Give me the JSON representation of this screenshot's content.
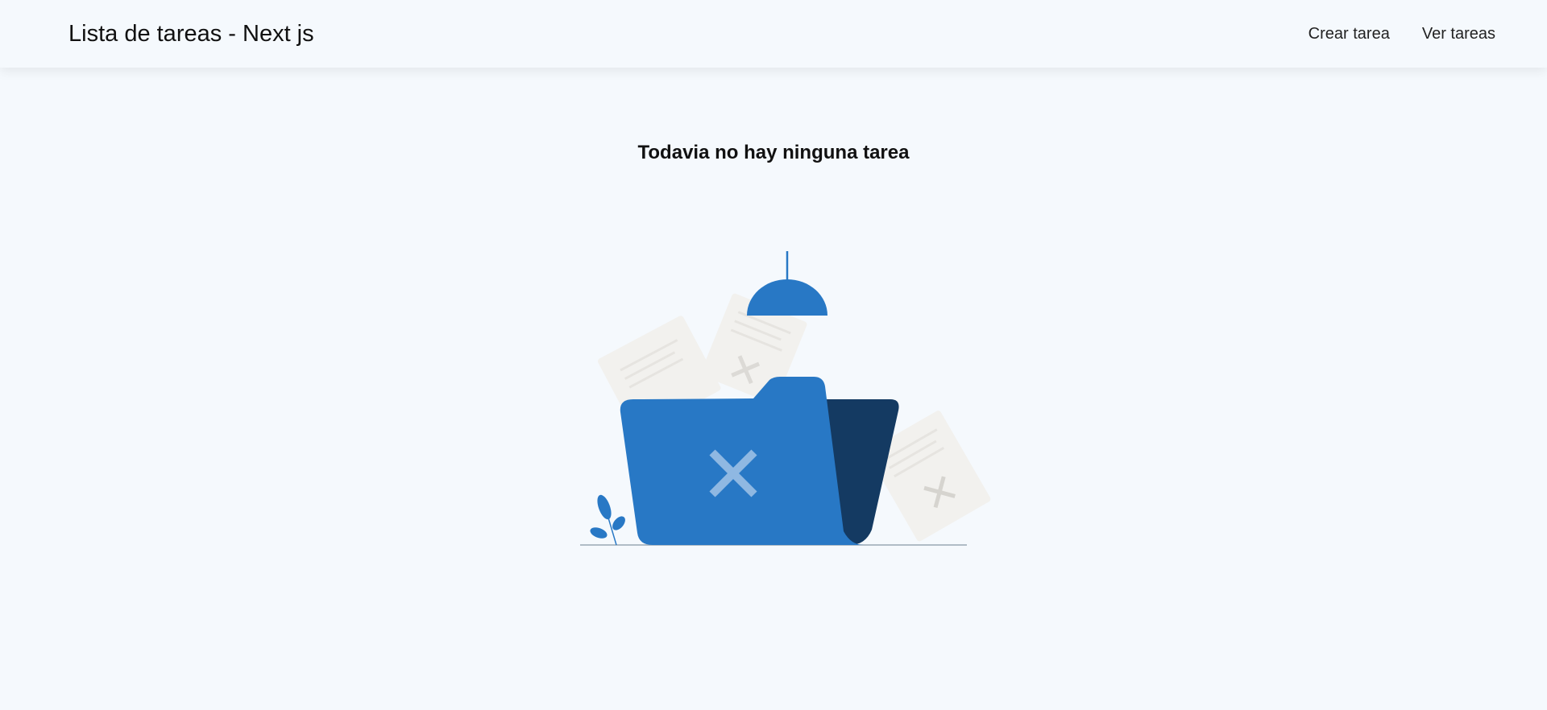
{
  "header": {
    "brand": "Lista de tareas - Next js",
    "nav": [
      {
        "label": "Crear tarea"
      },
      {
        "label": "Ver tareas"
      }
    ]
  },
  "main": {
    "empty_message": "Todavia no hay ninguna tarea",
    "illustration_icon": "empty-folder-icon"
  },
  "colors": {
    "background": "#f5f9fd",
    "accent": "#2878c5",
    "accent_dark": "#143a62",
    "paper": "#f2f1ee"
  }
}
